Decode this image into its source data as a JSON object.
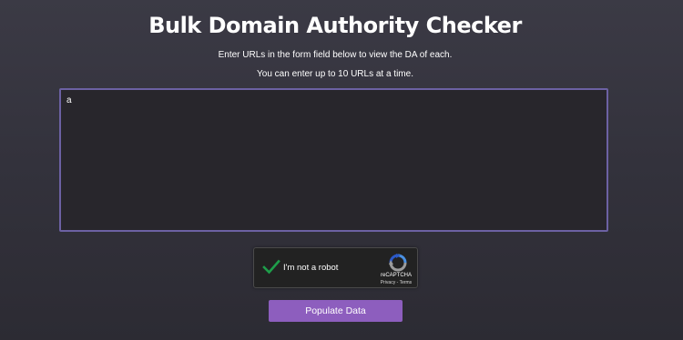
{
  "header": {
    "title": "Bulk Domain Authority Checker",
    "description_line1": "Enter URLs in the form field below to view the DA of each.",
    "description_line2": "You can enter up to 10 URLs at a time."
  },
  "form": {
    "urls_value": "a"
  },
  "captcha": {
    "label": "I'm not a robot",
    "checked": true,
    "brand": "reCAPTCHA",
    "privacy": "Privacy",
    "separator": " - ",
    "terms": "Terms",
    "check_icon": "checkmark-icon",
    "logo_icon": "recaptcha-logo-icon"
  },
  "actions": {
    "submit_label": "Populate Data"
  },
  "colors": {
    "accent": "#8d5ebe",
    "textarea_border": "#6c61a3",
    "check": "#1e9e4a"
  }
}
